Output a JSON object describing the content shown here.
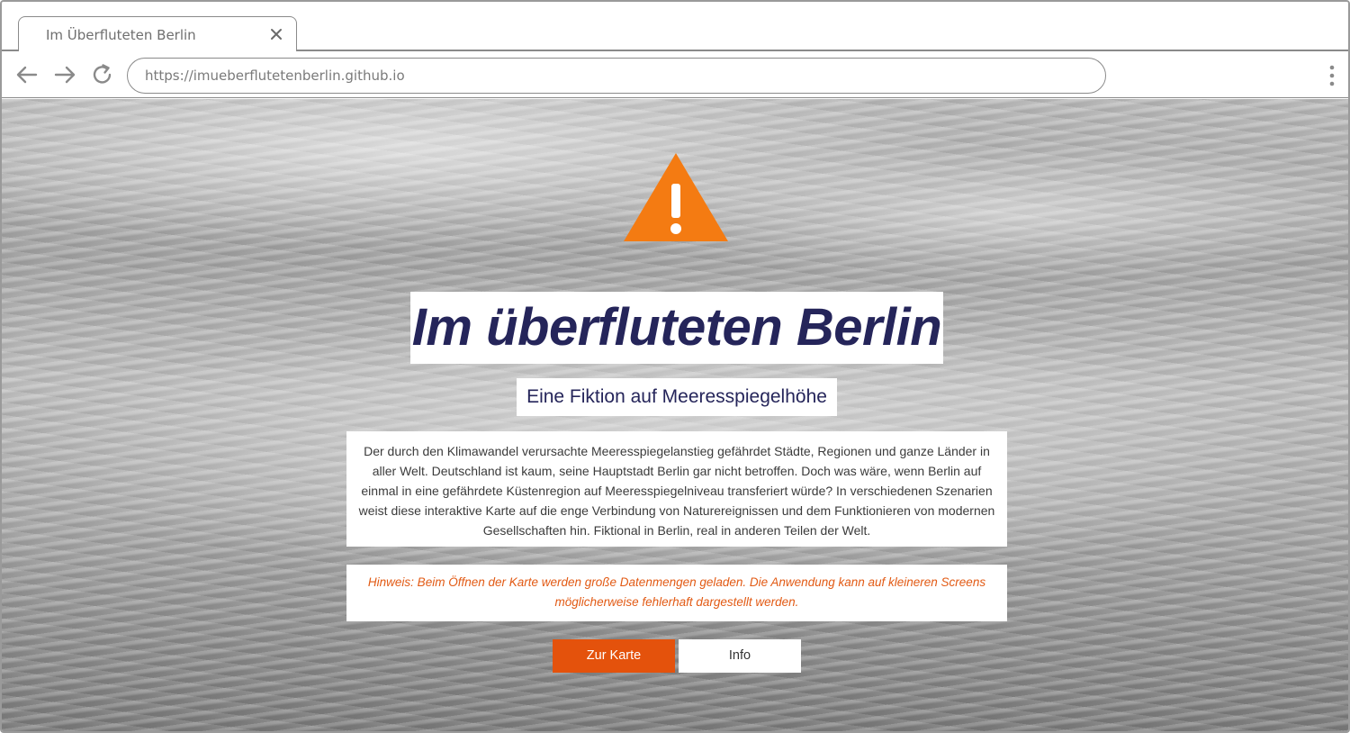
{
  "browser": {
    "tab_title": "Im Überfluteten Berlin",
    "url": "https://imueberflutetenberlin.github.io",
    "icons": [
      "back-arrow-icon",
      "forward-arrow-icon",
      "reload-icon",
      "close-icon",
      "more-menu-icon"
    ]
  },
  "page": {
    "warning_icon": "warning-triangle-icon",
    "title": "Im überfluteten Berlin",
    "subtitle": "Eine Fiktion auf Meeresspiegelhöhe",
    "description": "Der durch den Klimawandel verursachte Meeresspiegelanstieg gefährdet Städte, Regionen und ganze Länder in aller Welt. Deutschland ist kaum, seine Hauptstadt Berlin gar nicht betroffen. Doch was wäre, wenn Berlin auf einmal in eine gefährdete Küstenregion auf Meeresspiegelniveau transferiert würde? In verschiedenen Szenarien weist diese interaktive Karte auf die enge Verbindung von Naturereignissen und dem Funktionieren von modernen Gesellschaften hin. Fiktional in Berlin, real in anderen Teilen der Welt.",
    "note": "Hinweis: Beim Öffnen der Karte werden große Datenmengen geladen. Die Anwendung kann auf kleineren Screens möglicherweise fehlerhaft dargestellt werden.",
    "buttons": {
      "map_label": "Zur Karte",
      "info_label": "Info"
    }
  },
  "colors": {
    "accent": "#e4520c",
    "warning": "#f47b12",
    "title": "#25255a",
    "note": "#e25a14"
  }
}
